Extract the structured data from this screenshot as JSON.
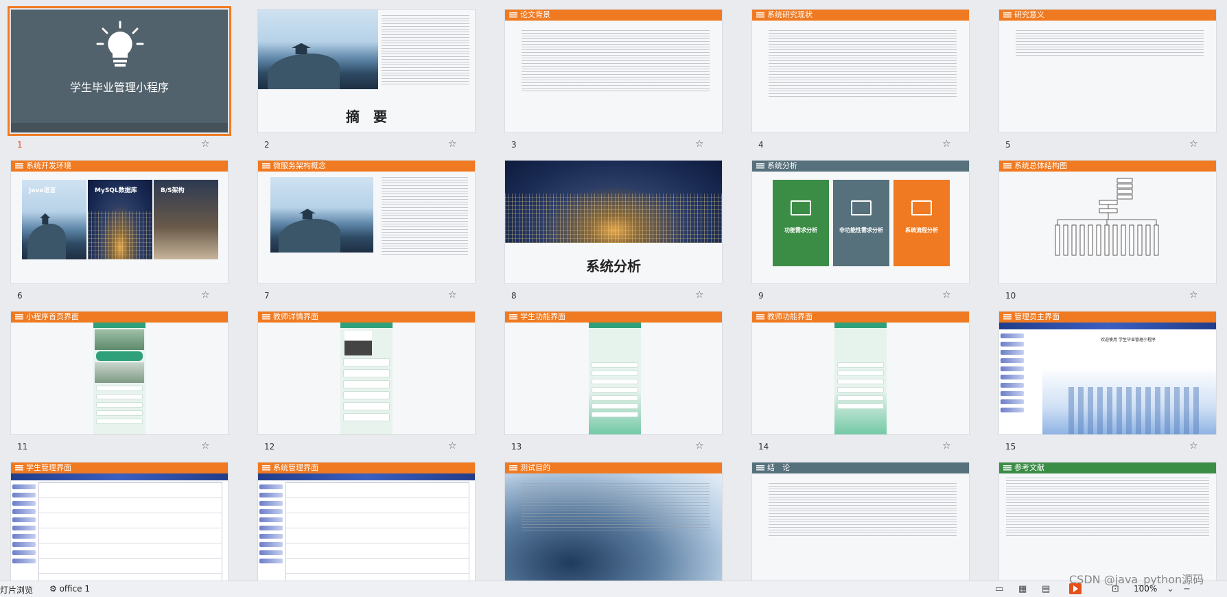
{
  "slides": [
    {
      "num": "1",
      "title": "学生毕业管理小程序"
    },
    {
      "num": "2",
      "title": "摘　要"
    },
    {
      "num": "3",
      "title": "论文背景"
    },
    {
      "num": "4",
      "title": "系统研究现状"
    },
    {
      "num": "5",
      "title": "研究意义"
    },
    {
      "num": "6",
      "title": "系统开发环境",
      "labels": [
        "Java语言",
        "MySQL数据库",
        "B/S架构"
      ]
    },
    {
      "num": "7",
      "title": "微服务架构概念"
    },
    {
      "num": "8",
      "title": "系统分析"
    },
    {
      "num": "9",
      "title": "系统分析",
      "labels": [
        "功能需求分析",
        "非功能性需求分析",
        "系统流程分析"
      ]
    },
    {
      "num": "10",
      "title": "系统总体结构图"
    },
    {
      "num": "11",
      "title": "小程序首页界面"
    },
    {
      "num": "12",
      "title": "教师详情界面"
    },
    {
      "num": "13",
      "title": "学生功能界面"
    },
    {
      "num": "14",
      "title": "教师功能界面"
    },
    {
      "num": "15",
      "title": "管理员主界面",
      "welcome": "欢迎使用 学生毕业管理小程序"
    },
    {
      "num": "",
      "title": "学生管理界面"
    },
    {
      "num": "",
      "title": "系统管理界面"
    },
    {
      "num": "",
      "title": "测试目的"
    },
    {
      "num": "",
      "title": "结　论"
    },
    {
      "num": "",
      "title": "参考文献"
    }
  ],
  "status_bar": {
    "view_label": "灯片浏览",
    "theme": "office 1",
    "zoom": "100%",
    "watermark": "CSDN @java_python源码"
  },
  "colors": {
    "accent": "#f07a21",
    "gray": "#56707c",
    "green": "#3b8c45",
    "selection": "#e5501b"
  }
}
